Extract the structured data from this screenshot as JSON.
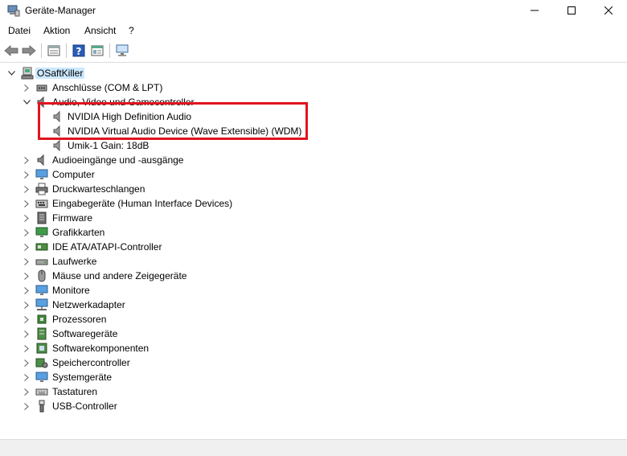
{
  "window": {
    "title": "Geräte-Manager",
    "minimize_glyph": "─",
    "maximize_glyph": "☐",
    "close_glyph": "✕"
  },
  "menu": [
    "Datei",
    "Aktion",
    "Ansicht",
    "?"
  ],
  "toolbar": {
    "buttons": [
      "back-arrow-icon",
      "forward-arrow-icon",
      "properties-icon",
      "help-icon",
      "console-icon",
      "monitor-scan-icon"
    ]
  },
  "tree": {
    "root": "OSaftKiller",
    "audio_category_label": "Audio, Video und Gamecontroller",
    "categories": [
      "Anschlüsse (COM & LPT)",
      "Audio, Video und Gamecontroller",
      "Audioeingänge und -ausgänge",
      "Computer",
      "Druckwarteschlangen",
      "Eingabegeräte (Human Interface Devices)",
      "Firmware",
      "Grafikkarten",
      "IDE ATA/ATAPI-Controller",
      "Laufwerke",
      "Mäuse und andere Zeigegeräte",
      "Monitore",
      "Netzwerkadapter",
      "Prozessoren",
      "Softwaregeräte",
      "Softwarekomponenten",
      "Speichercontroller",
      "Systemgeräte",
      "Tastaturen",
      "USB-Controller"
    ],
    "audio_children": [
      "NVIDIA High Definition Audio",
      "NVIDIA Virtual Audio Device (Wave Extensible) (WDM)",
      "Umik-1  Gain: 18dB"
    ]
  },
  "colors": {
    "selection": "#cce8ff",
    "highlight_box": "#e0141e"
  }
}
